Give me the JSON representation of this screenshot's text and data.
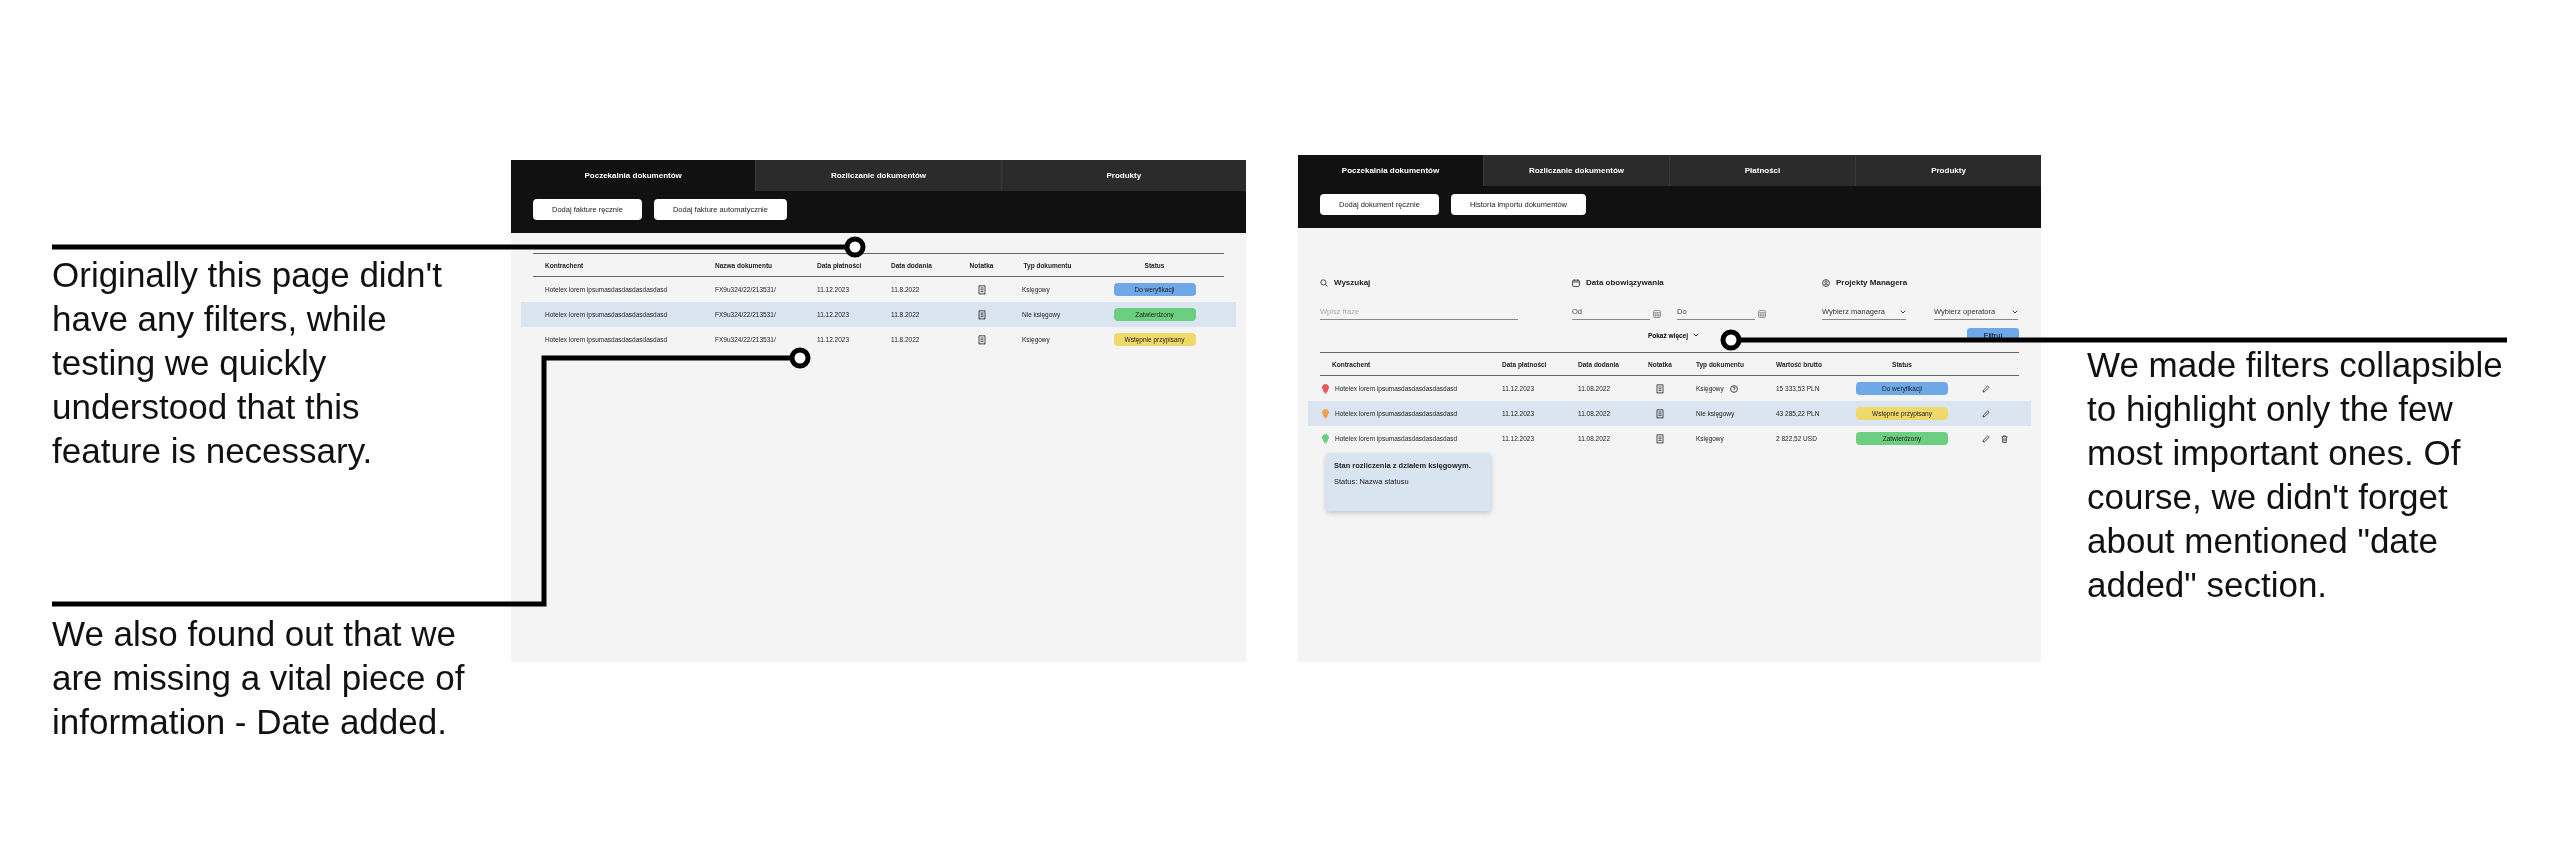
{
  "annotations": [
    {
      "text": "Originally this page didn't have any filters, while testing we quickly understood that this feature is necessary."
    },
    {
      "text": "We also found out that we are missing a vital piece of information - Date added."
    },
    {
      "text": "We made filters collapsible to highlight only the few most important ones. Of course, we didn't forget about mentioned \"date added\" section."
    }
  ],
  "old_screen": {
    "tabs": [
      {
        "label": "Poczekalnia dokumentów",
        "selected": true
      },
      {
        "label": "Rozliczanie dokumentów",
        "selected": false
      },
      {
        "label": "Produkty",
        "selected": false
      }
    ],
    "buttons": [
      "Dodaj fakture ręcznie",
      "Dodaj fakture automatycznie"
    ],
    "table": {
      "columns": [
        "Kontrachent",
        "Nazwa dokumentu",
        "Data płatności",
        "Data dodania",
        "Notatka",
        "Typ dokumentu",
        "Status"
      ],
      "rows": [
        {
          "contractor": "Hotelex lorem ipsumasdasdasdasdasdasd",
          "document": "FX9u324/22/213531/",
          "payment_date": "11.12.2023",
          "added_date": "11.8.2022",
          "type": "Księgowy",
          "status": {
            "label": "Do weryfikacji",
            "color": "#6fa8e8"
          },
          "selected": false
        },
        {
          "contractor": "Hotelex lorem ipsumasdasdasdasdasdasd",
          "document": "FX9u324/22/213531/",
          "payment_date": "11.12.2023",
          "added_date": "11.8.2022",
          "type": "Nie księgowy",
          "status": {
            "label": "Zatwierdzony",
            "color": "#6bcf7f"
          },
          "selected": true
        },
        {
          "contractor": "Hotelex lorem ipsumasdasdasdasdasdasd",
          "document": "FX9u324/22/213531/",
          "payment_date": "11.12.2023",
          "added_date": "11.8.2022",
          "type": "Księgowy",
          "status": {
            "label": "Wstępnie przypisany",
            "color": "#efd96b"
          },
          "selected": false
        }
      ]
    }
  },
  "new_screen": {
    "tabs": [
      {
        "label": "Poczekalnia dokumentów",
        "selected": true
      },
      {
        "label": "Rozliczanie dokumentów",
        "selected": false
      },
      {
        "label": "Płatności",
        "selected": false
      },
      {
        "label": "Produkty",
        "selected": false
      }
    ],
    "buttons": [
      "Dodaj dokument ręcznie",
      "Historia importu dokumentów"
    ],
    "filters": [
      {
        "kind": "search",
        "label": "Wyszukaj",
        "fields": [
          {
            "placeholder": "Wpisz fraze"
          }
        ]
      },
      {
        "kind": "date",
        "label": "Data obowiązywania",
        "fields": [
          {
            "placeholder": "Od"
          },
          {
            "placeholder": "Do"
          }
        ]
      },
      {
        "kind": "select",
        "label": "Projekty Managera",
        "fields": [
          {
            "placeholder": "Wybierz managera"
          },
          {
            "placeholder": "Wybierz operatora"
          }
        ]
      }
    ],
    "show_more": "Pokaż więcej",
    "filter_button": "Filtruj",
    "table": {
      "columns": [
        "Kontrachent",
        "Data płatności",
        "Data dodania",
        "Notatka",
        "Typ dokumentu",
        "Wartość brutto",
        "Status"
      ],
      "rows": [
        {
          "color": "#e8595a",
          "contractor": "Hotelex lorem ipsumasdasdasdasdasdasd",
          "payment_date": "11.12.2023",
          "added_date": "11.08.2022",
          "type": "Księgowy",
          "help": true,
          "value": "15 333,53 PLN",
          "status": {
            "label": "Do weryfikacji",
            "color": "#6fa8e8"
          },
          "deletable": false,
          "selected": false
        },
        {
          "color": "#f0a050",
          "contractor": "Hotelex lorem ipsumasdasdasdasdasdasd",
          "payment_date": "11.12.2023",
          "added_date": "11.08.2022",
          "type": "Nie księgowy",
          "help": false,
          "value": "43 285,22 PLN",
          "status": {
            "label": "Wstępnie przypisany",
            "color": "#efd96b"
          },
          "deletable": false,
          "selected": true
        },
        {
          "color": "#6bcf7f",
          "contractor": "Hotelex lorem ipsumasdasdasdasdasdasd",
          "payment_date": "11.12.2023",
          "added_date": "11.08.2022",
          "type": "Księgowy",
          "help": false,
          "value": "2 822,52 USD",
          "status": {
            "label": "Zatwierdzony",
            "color": "#6bcf7f"
          },
          "deletable": true,
          "selected": false
        }
      ]
    },
    "tooltip": {
      "title": "Stan rozliczenia z działem księgowym.",
      "text": "Status: Nazwa statusu"
    }
  }
}
